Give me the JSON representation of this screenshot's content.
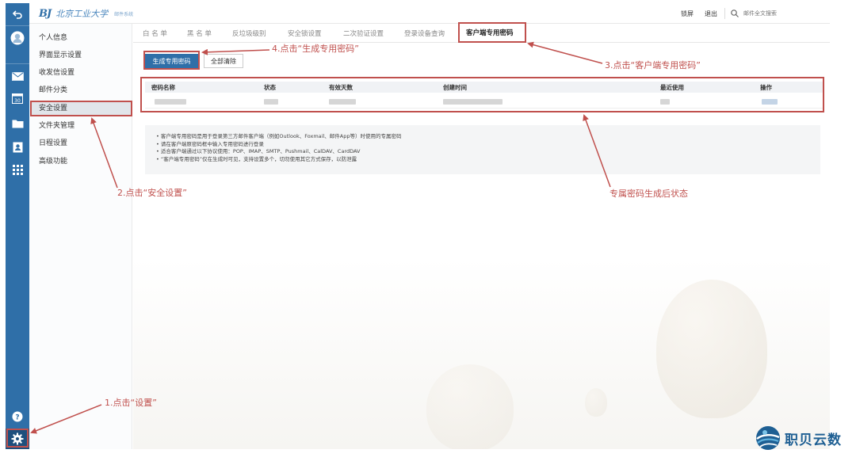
{
  "app": {
    "logo_mark": "BJ",
    "logo_text": "北京工业大学",
    "logo_sub": "邮件系统"
  },
  "topbar": {
    "lock_screen": "锁屏",
    "logout": "退出",
    "search_placeholder": "邮件全文搜索"
  },
  "sidebar": {
    "items": [
      {
        "label": "个人信息"
      },
      {
        "label": "界面显示设置"
      },
      {
        "label": "收发信设置"
      },
      {
        "label": "邮件分类"
      },
      {
        "label": "安全设置"
      },
      {
        "label": "文件夹管理"
      },
      {
        "label": "日程设置"
      },
      {
        "label": "高级功能"
      }
    ]
  },
  "tabs": [
    {
      "label": "白 名 单"
    },
    {
      "label": "黑 名 单"
    },
    {
      "label": "反垃圾级别"
    },
    {
      "label": "安全锁设置"
    },
    {
      "label": "二次验证设置"
    },
    {
      "label": "登录设备查询"
    },
    {
      "label": "客户端专用密码"
    }
  ],
  "actions": {
    "generate": "生成专用密码",
    "clear_all": "全部清除"
  },
  "table": {
    "headers": [
      "密码名称",
      "状态",
      "有效天数",
      "创建时间",
      "最近使用",
      "操作"
    ]
  },
  "notes": [
    "• 客户端专用密码是用于登录第三方邮件客户端（例如Outlook、Foxmail、邮件App等）时使用的专属密码",
    "• 请在客户端原密码框中输入专用密码进行登录",
    "• 适合客户端通过以下协议使用：POP、IMAP、SMTP、Pushmail、CalDAV、CardDAV",
    "• “客户端专用密码”仅在生成时可见，支持设置多个，切勿使用其它方式保存，以防泄露"
  ],
  "annotations": {
    "step1": "1.点击“设置”",
    "step2": "2.点击“安全设置”",
    "step3": "3.点击“客户端专用密码”",
    "step4": "4.点击“生成专用密码”",
    "state": "专属密码生成后状态",
    "color": "#c0504d"
  },
  "brand": {
    "text": "职贝云数"
  },
  "colors": {
    "primary": "#2f6fa8",
    "rail": "#2f6fa8",
    "annotation": "#c0504d"
  }
}
